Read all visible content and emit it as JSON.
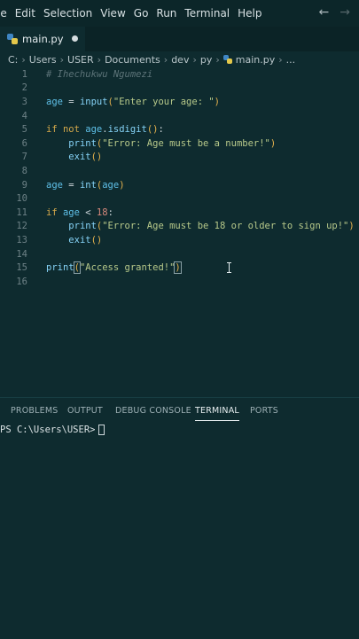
{
  "menu": {
    "items": [
      "le",
      "Edit",
      "Selection",
      "View",
      "Go",
      "Run",
      "Terminal",
      "Help"
    ]
  },
  "tab": {
    "name": "main.py"
  },
  "breadcrumb": [
    "C:",
    "Users",
    "USER",
    "Documents",
    "dev",
    "py",
    "main.py",
    "..."
  ],
  "editor": {
    "lines": [
      {
        "num": "1",
        "tokens": [
          [
            "com",
            "# Ihechukwu Ngumezi"
          ]
        ]
      },
      {
        "num": "2",
        "tokens": []
      },
      {
        "num": "3",
        "tokens": [
          [
            "var",
            "age"
          ],
          [
            "op",
            " = "
          ],
          [
            "fn",
            "input"
          ],
          [
            "br",
            "("
          ],
          [
            "str",
            "\"Enter your age: \""
          ],
          [
            "br",
            ")"
          ]
        ]
      },
      {
        "num": "4",
        "tokens": []
      },
      {
        "num": "5",
        "tokens": [
          [
            "kw",
            "if not "
          ],
          [
            "var",
            "age"
          ],
          [
            "op",
            "."
          ],
          [
            "fn",
            "isdigit"
          ],
          [
            "br",
            "()"
          ],
          [
            "op",
            ":"
          ]
        ]
      },
      {
        "num": "6",
        "tokens": [
          [
            "op",
            "    "
          ],
          [
            "fn",
            "print"
          ],
          [
            "br",
            "("
          ],
          [
            "str",
            "\"Error: Age must be a number!\""
          ],
          [
            "br",
            ")"
          ]
        ]
      },
      {
        "num": "7",
        "tokens": [
          [
            "op",
            "    "
          ],
          [
            "fn",
            "exit"
          ],
          [
            "br",
            "()"
          ]
        ]
      },
      {
        "num": "8",
        "tokens": []
      },
      {
        "num": "9",
        "tokens": [
          [
            "var",
            "age"
          ],
          [
            "op",
            " = "
          ],
          [
            "fn",
            "int"
          ],
          [
            "br",
            "("
          ],
          [
            "var",
            "age"
          ],
          [
            "br",
            ")"
          ]
        ]
      },
      {
        "num": "10",
        "tokens": []
      },
      {
        "num": "11",
        "tokens": [
          [
            "kw",
            "if "
          ],
          [
            "var",
            "age"
          ],
          [
            "op",
            " < "
          ],
          [
            "num",
            "18"
          ],
          [
            "op",
            ":"
          ]
        ]
      },
      {
        "num": "12",
        "tokens": [
          [
            "op",
            "    "
          ],
          [
            "fn",
            "print"
          ],
          [
            "br",
            "("
          ],
          [
            "str",
            "\"Error: Age must be 18 or older to sign up!\""
          ],
          [
            "br",
            ")"
          ]
        ]
      },
      {
        "num": "13",
        "tokens": [
          [
            "op",
            "    "
          ],
          [
            "fn",
            "exit"
          ],
          [
            "br",
            "()"
          ]
        ]
      },
      {
        "num": "14",
        "tokens": []
      },
      {
        "num": "15",
        "tokens": [
          [
            "fn",
            "print"
          ],
          [
            "brh",
            "("
          ],
          [
            "str",
            "\"Access granted!\""
          ],
          [
            "brh",
            ")"
          ],
          [
            "caret",
            ""
          ]
        ]
      },
      {
        "num": "16",
        "tokens": []
      }
    ]
  },
  "panel": {
    "tabs": [
      "PROBLEMS",
      "OUTPUT",
      "DEBUG CONSOLE",
      "TERMINAL",
      "PORTS"
    ],
    "active_tab": "TERMINAL",
    "prompt": "PS C:\\Users\\USER>"
  }
}
